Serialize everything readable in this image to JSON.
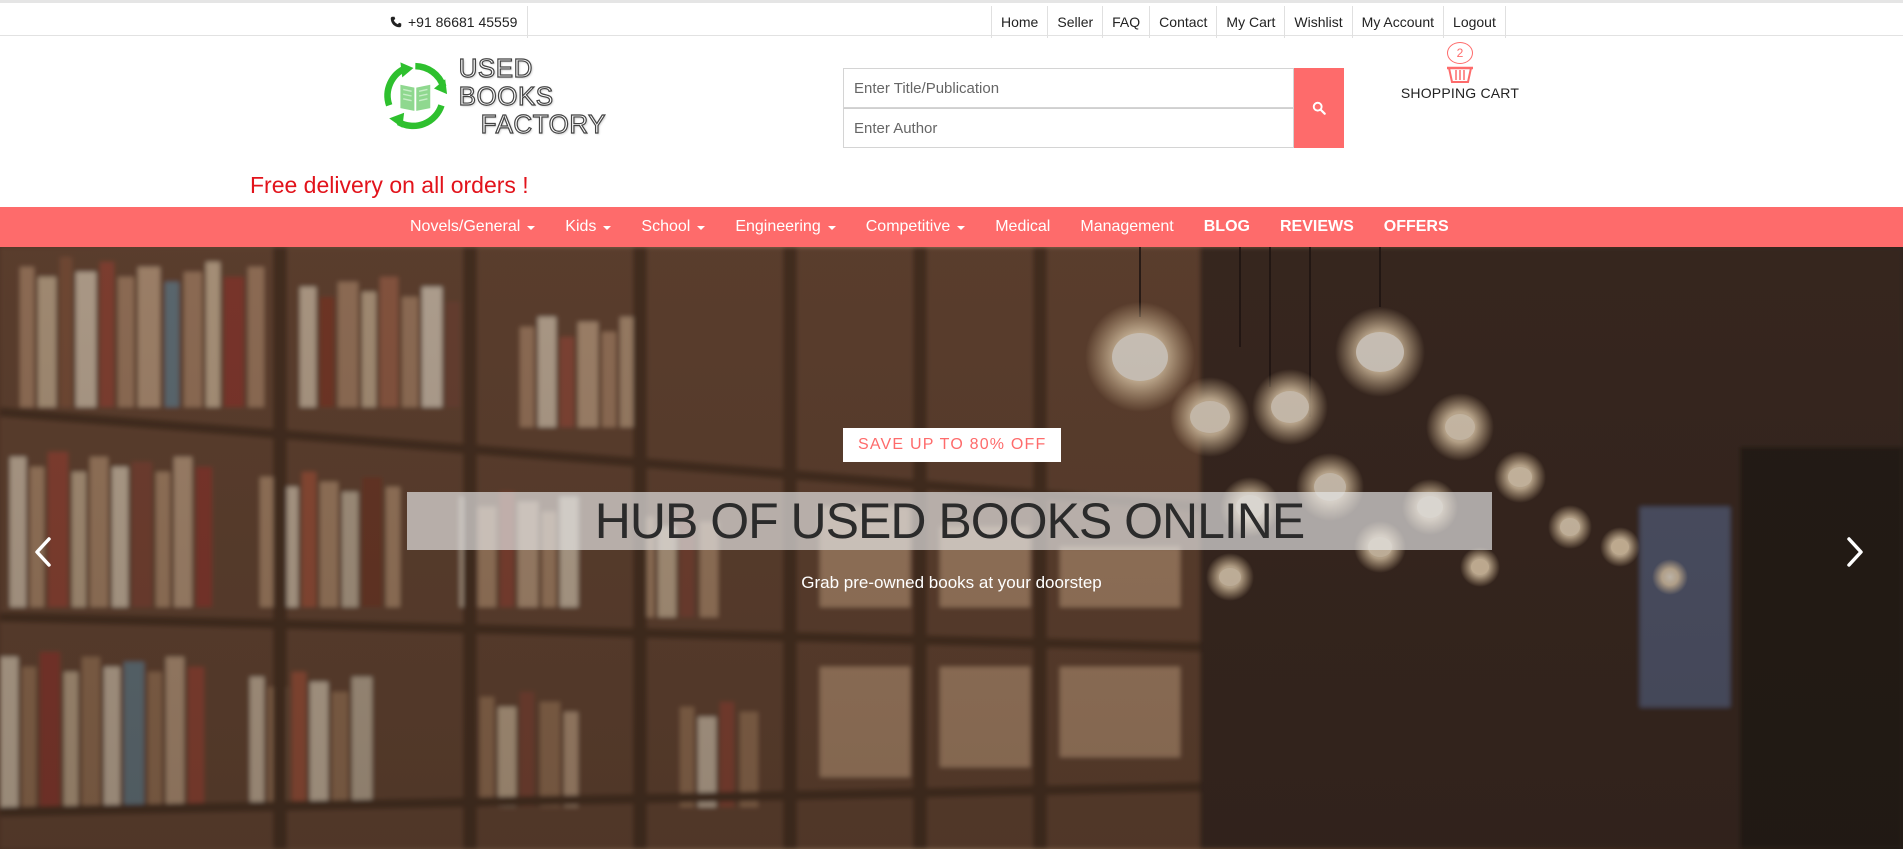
{
  "topbar": {
    "phone": "+91 86681 45559",
    "links": [
      "Home",
      "Seller",
      "FAQ",
      "Contact",
      "My Cart",
      "Wishlist",
      "My Account",
      "Logout"
    ]
  },
  "logo": {
    "line1": "USED BOOKS",
    "line2": "FACTORY"
  },
  "search": {
    "title_placeholder": "Enter Title/Publication",
    "author_placeholder": "Enter Author"
  },
  "cart": {
    "count": "2",
    "label": "SHOPPING CART"
  },
  "promo": "Free delivery on all orders !",
  "nav": [
    {
      "label": "Novels/General",
      "dropdown": true,
      "bold": false
    },
    {
      "label": "Kids",
      "dropdown": true,
      "bold": false
    },
    {
      "label": "School",
      "dropdown": true,
      "bold": false
    },
    {
      "label": "Engineering",
      "dropdown": true,
      "bold": false
    },
    {
      "label": "Competitive",
      "dropdown": true,
      "bold": false
    },
    {
      "label": "Medical",
      "dropdown": false,
      "bold": false
    },
    {
      "label": "Management",
      "dropdown": false,
      "bold": false
    },
    {
      "label": "BLOG",
      "dropdown": false,
      "bold": true
    },
    {
      "label": "REVIEWS",
      "dropdown": false,
      "bold": true
    },
    {
      "label": "OFFERS",
      "dropdown": false,
      "bold": true
    }
  ],
  "hero": {
    "badge": "SAVE UP TO 80% OFF",
    "headline": "HUB OF USED BOOKS ONLINE",
    "subline": "Grab pre-owned books at your doorstep"
  },
  "colors": {
    "accent": "#fe6b6b",
    "promo": "#e2131b",
    "logo_green": "#2ec02e"
  },
  "icons": {
    "phone": "phone-icon",
    "search": "search-icon",
    "cart": "basket-icon",
    "prev": "chevron-left-icon",
    "next": "chevron-right-icon"
  }
}
